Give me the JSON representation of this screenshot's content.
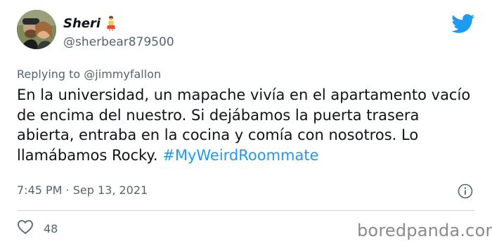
{
  "author": {
    "name": "Sheri",
    "handle": "@sherbear879500"
  },
  "tweet": {
    "replying_prefix": "Replying to ",
    "replying_to": "@jimmyfallon",
    "text": "En la universidad, un mapache vivía en el apartamento vacío de encima del nuestro. Si dejábamos la puerta trasera abierta, entraba en la cocina y comía con nosotros. Lo llamábamos Rocky. ",
    "hashtag": "#MyWeirdRoommate",
    "timestamp": "7:45 PM · Sep 13, 2021",
    "likes": "48"
  },
  "watermark": "boredpanda.com",
  "colors": {
    "hashtag": "#1d9bf0",
    "twitter_blue": "#1d9bf0",
    "secondary_text": "#536471"
  },
  "icons": [
    "twitter-bird-icon",
    "info-icon",
    "heart-icon",
    "woman-emoji-icon"
  ]
}
